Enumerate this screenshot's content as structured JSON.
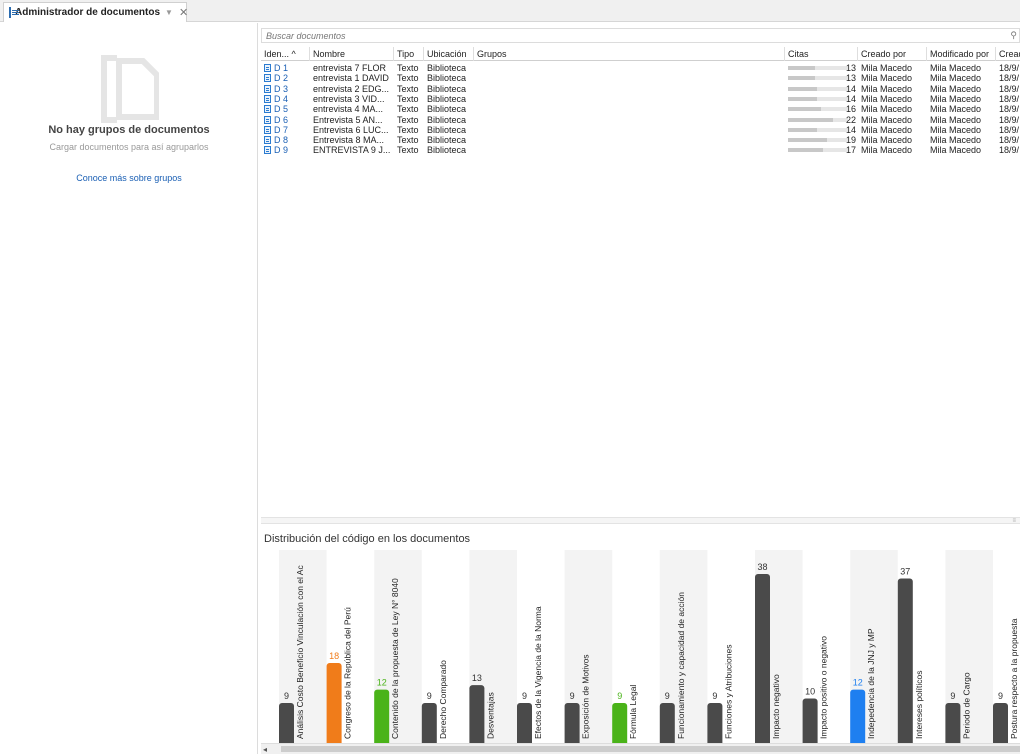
{
  "tab": {
    "title": "Administrador de documentos",
    "arrow": "▼",
    "close": "✕"
  },
  "left": {
    "no_groups": "No hay grupos de documentos",
    "load_docs": "Cargar documentos para así agruparlos",
    "learn_more": "Conoce más sobre grupos"
  },
  "search": {
    "placeholder": "Buscar documentos"
  },
  "table": {
    "headers": [
      "Iden... ^",
      "Nombre",
      "Tipo",
      "Ubicación",
      "Grupos",
      "Citas",
      "Creado por",
      "Modificado por",
      "Cread"
    ],
    "rows": [
      {
        "id": "D 1",
        "name": "entrevista  7 FLOR",
        "type": "Texto",
        "loc": "Biblioteca",
        "citas": 13,
        "created_by": "Mila Macedo",
        "modified_by": "Mila Macedo",
        "created": "18/9/"
      },
      {
        "id": "D 2",
        "name": "entrevista 1 DAVID",
        "type": "Texto",
        "loc": "Biblioteca",
        "citas": 13,
        "created_by": "Mila Macedo",
        "modified_by": "Mila Macedo",
        "created": "18/9/"
      },
      {
        "id": "D 3",
        "name": "entrevista 2 EDG...",
        "type": "Texto",
        "loc": "Biblioteca",
        "citas": 14,
        "created_by": "Mila Macedo",
        "modified_by": "Mila Macedo",
        "created": "18/9/"
      },
      {
        "id": "D 4",
        "name": "entrevista 3 VID...",
        "type": "Texto",
        "loc": "Biblioteca",
        "citas": 14,
        "created_by": "Mila Macedo",
        "modified_by": "Mila Macedo",
        "created": "18/9/"
      },
      {
        "id": "D 5",
        "name": "entrevista 4 MA...",
        "type": "Texto",
        "loc": "Biblioteca",
        "citas": 16,
        "created_by": "Mila Macedo",
        "modified_by": "Mila Macedo",
        "created": "18/9/"
      },
      {
        "id": "D 6",
        "name": "Entrevista 5 AN...",
        "type": "Texto",
        "loc": "Biblioteca",
        "citas": 22,
        "created_by": "Mila Macedo",
        "modified_by": "Mila Macedo",
        "created": "18/9/"
      },
      {
        "id": "D 7",
        "name": "Entrevista 6 LUC...",
        "type": "Texto",
        "loc": "Biblioteca",
        "citas": 14,
        "created_by": "Mila Macedo",
        "modified_by": "Mila Macedo",
        "created": "18/9/"
      },
      {
        "id": "D 8",
        "name": "Entrevista 8 MA...",
        "type": "Texto",
        "loc": "Biblioteca",
        "citas": 19,
        "created_by": "Mila Macedo",
        "modified_by": "Mila Macedo",
        "created": "18/9/"
      },
      {
        "id": "D 9",
        "name": "ENTREVISTA 9  J...",
        "type": "Texto",
        "loc": "Biblioteca",
        "citas": 17,
        "created_by": "Mila Macedo",
        "modified_by": "Mila Macedo",
        "created": "18/9/"
      }
    ]
  },
  "distribution": {
    "title": "Distribución del código en los documentos"
  },
  "chart_data": {
    "type": "bar",
    "categories": [
      "Análisis Costo Beneficio Vinculación con el Ac",
      "Congreso de la República del Perú",
      "Contenido de la propuesta de Ley N° 8040",
      "Derecho Comparado",
      "Desventajas",
      "Efectos de la Vigencia de la Norma",
      "Exposición de Motivos",
      "Fórmula Legal",
      "Funcionamiento y capacidad de acción",
      "Funciones y Atribuciones",
      "Impacto negativo",
      "Impacto positivo o negativo",
      "Indepedencia de la JNJ y MP",
      "Intereses políticos",
      "Periodo de Cargo",
      "Postura respecto a la propuesta"
    ],
    "values": [
      9,
      18,
      12,
      9,
      13,
      9,
      9,
      9,
      9,
      9,
      38,
      10,
      12,
      37,
      9,
      9
    ],
    "colors": [
      "#4a4a4a",
      "#f07c1a",
      "#4ab319",
      "#4a4a4a",
      "#4a4a4a",
      "#4a4a4a",
      "#4a4a4a",
      "#4ab319",
      "#4a4a4a",
      "#4a4a4a",
      "#4a4a4a",
      "#4a4a4a",
      "#1e7ff0",
      "#4a4a4a",
      "#4a4a4a",
      "#4a4a4a"
    ],
    "label_colors": [
      "#333333",
      "#f07c1a",
      "#4ab319",
      "#333333",
      "#333333",
      "#333333",
      "#333333",
      "#4ab319",
      "#333333",
      "#333333",
      "#333333",
      "#333333",
      "#1e7ff0",
      "#333333",
      "#333333",
      "#333333"
    ],
    "ylim": [
      0,
      38
    ]
  }
}
